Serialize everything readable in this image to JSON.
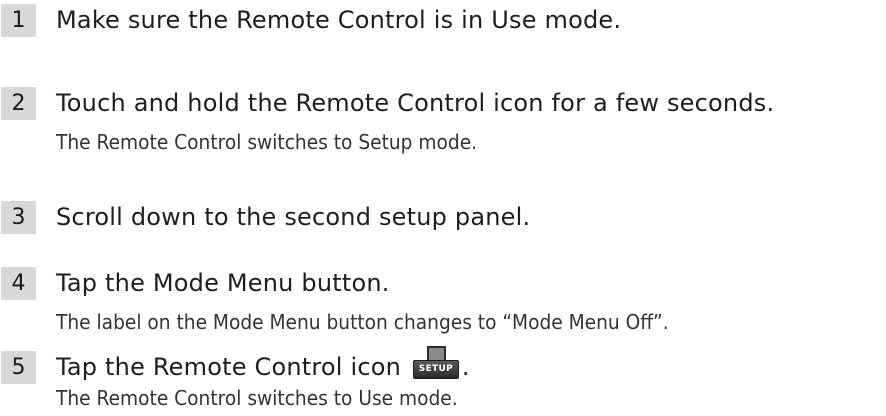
{
  "steps": [
    {
      "number": "1",
      "text": "Make sure the Remote Control is in Use mode.",
      "subtext": ""
    },
    {
      "number": "2",
      "text": "Touch and hold the Remote Control icon for a few seconds.",
      "subtext": "The Remote Control switches to Setup mode."
    },
    {
      "number": "3",
      "text": "Scroll down to the second setup panel.",
      "subtext": ""
    },
    {
      "number": "4",
      "text": "Tap the Mode Menu button.",
      "subtext": "The label on the Mode Menu button changes to “Mode Menu Off”."
    },
    {
      "number": "5",
      "text": "Tap the Remote Control icon",
      "text_end": ".",
      "subtext": "The Remote Control switches to Use mode."
    }
  ],
  "setup_icon": {
    "label": "SETUP",
    "icon": "remote-control-setup-icon"
  }
}
